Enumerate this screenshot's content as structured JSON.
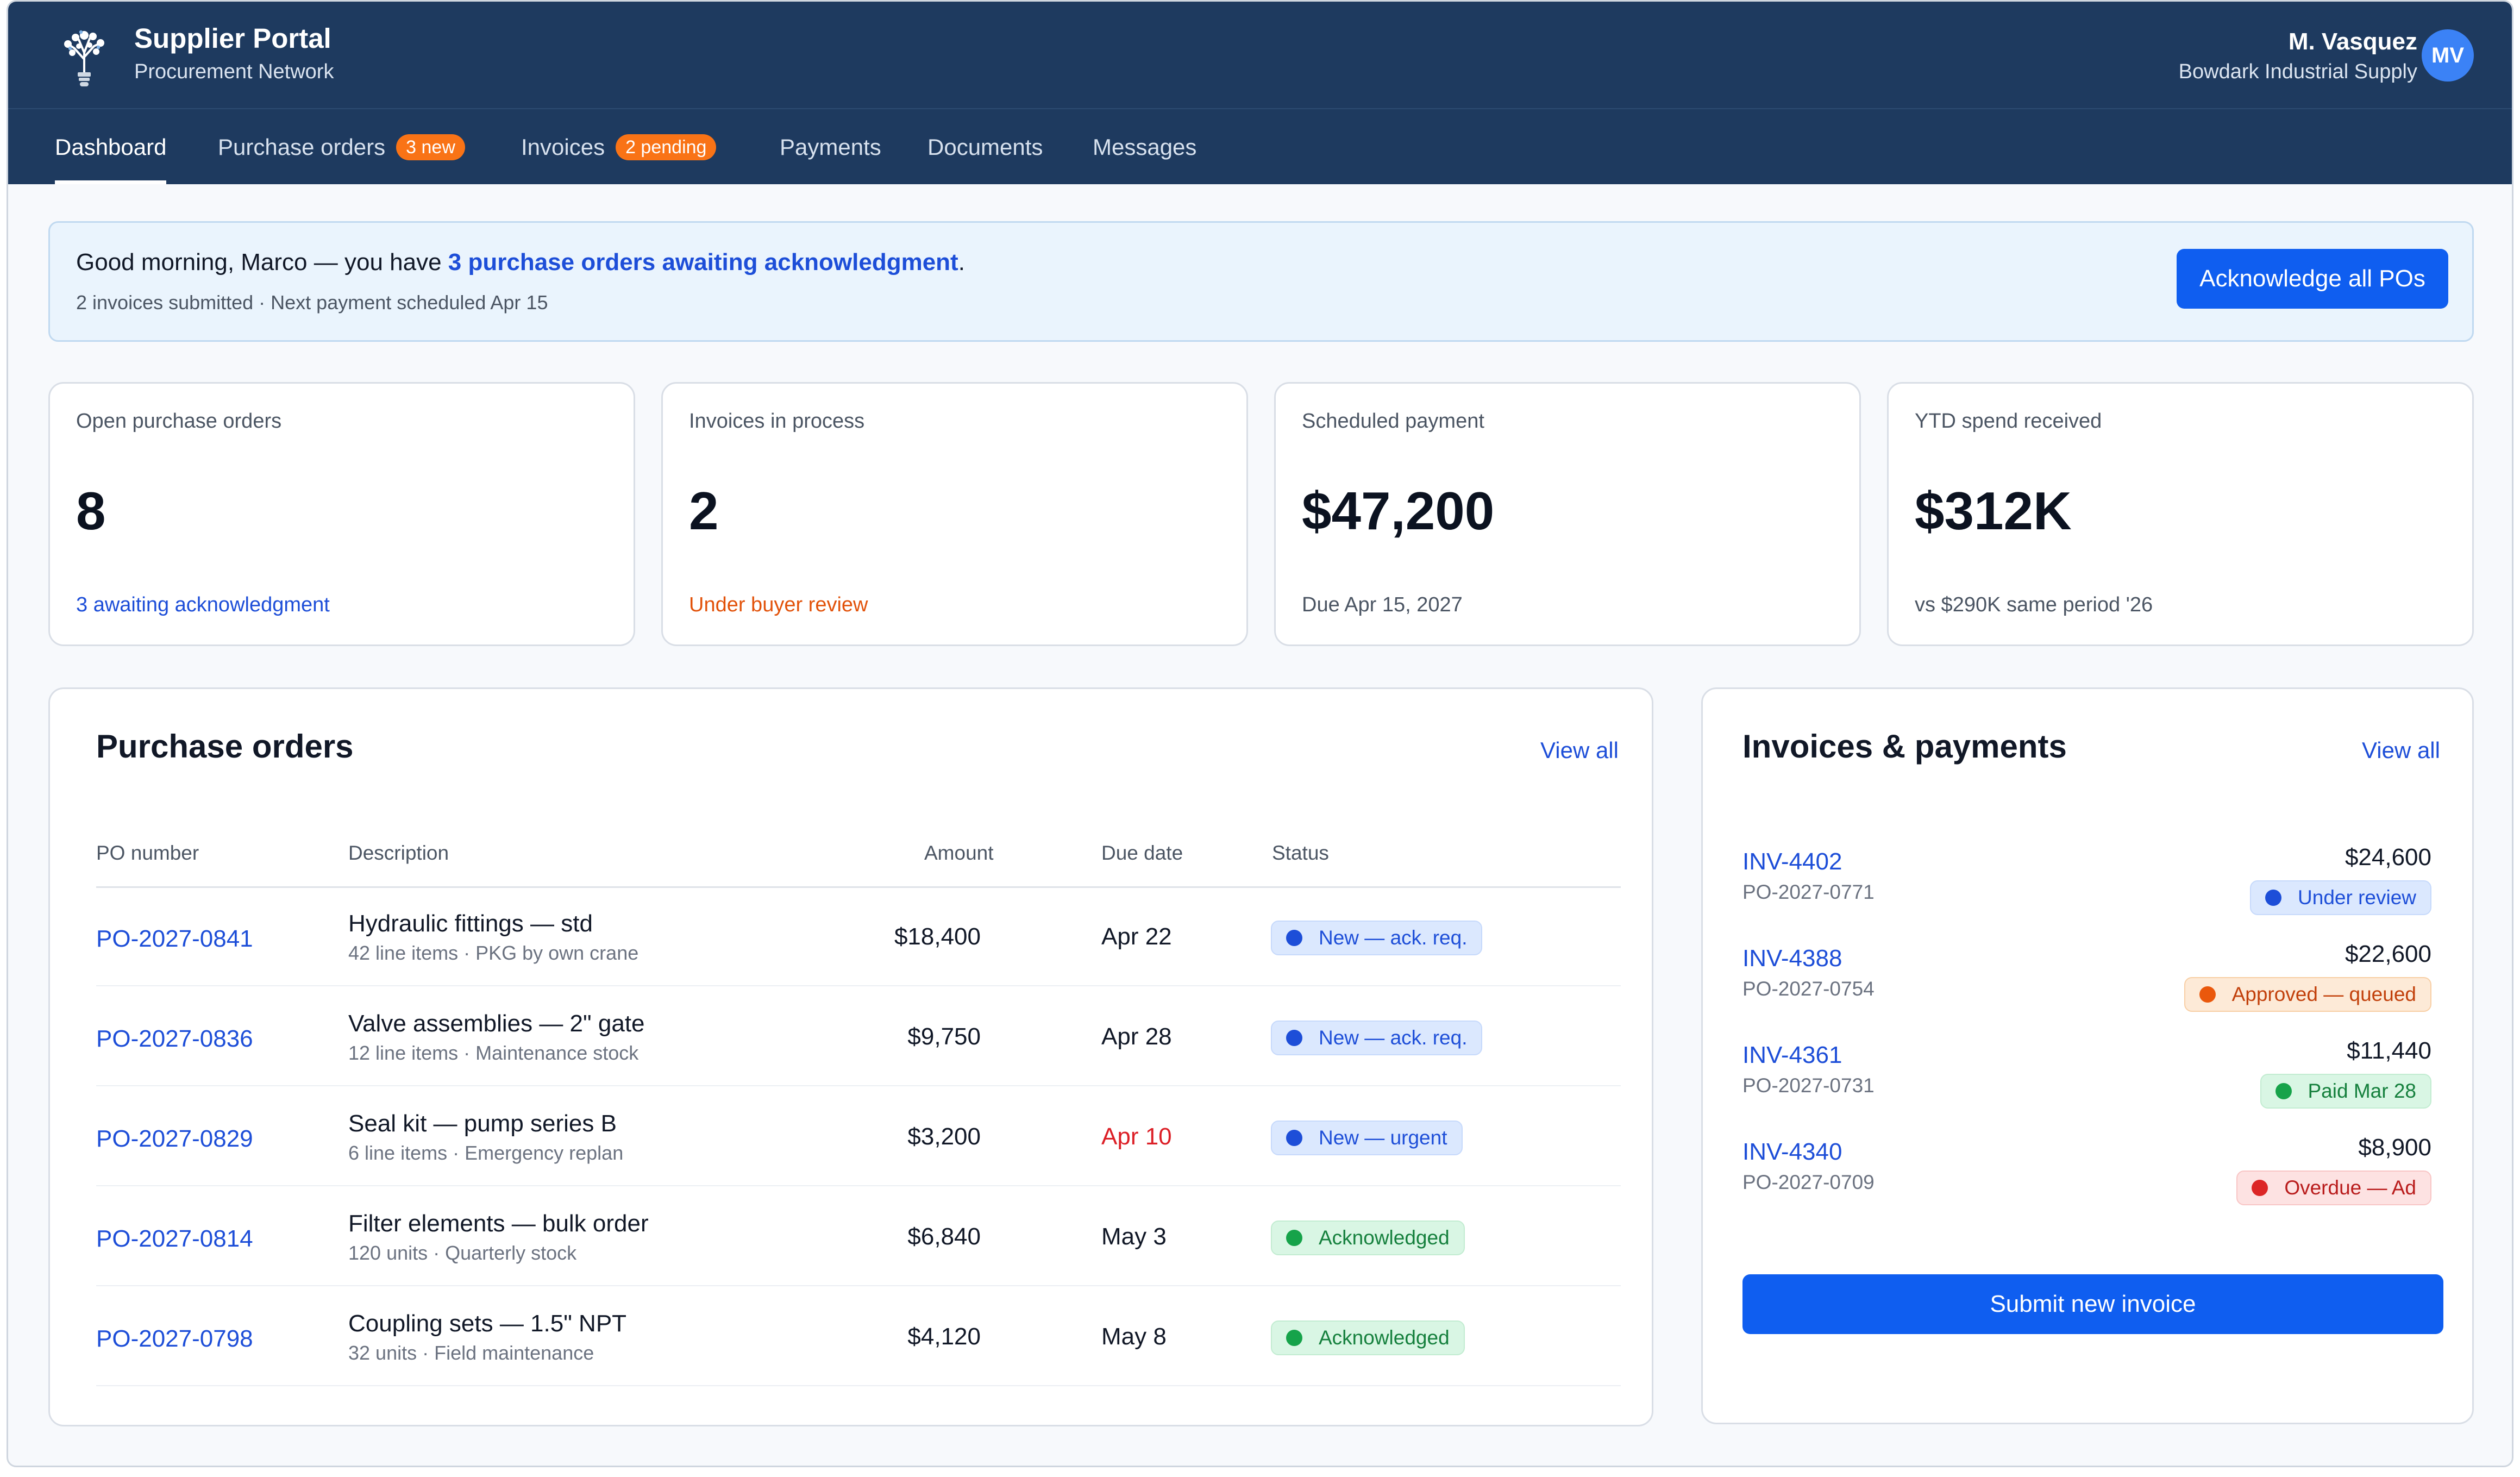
{
  "app": {
    "title": "Supplier Portal",
    "subtitle": "Procurement Network",
    "logo_icon": "lightbulb-tree-icon"
  },
  "user": {
    "name": "M. Vasquez",
    "company": "Bowdark Industrial Supply",
    "initials": "MV"
  },
  "nav": {
    "tabs": [
      {
        "label": "Dashboard",
        "active": true
      },
      {
        "label": "Purchase orders",
        "badge": "3 new"
      },
      {
        "label": "Invoices",
        "badge": "2 pending"
      },
      {
        "label": "Payments"
      },
      {
        "label": "Documents"
      },
      {
        "label": "Messages"
      }
    ]
  },
  "banner": {
    "greeting": "Good morning, Marco — you have ",
    "link": "3 purchase orders awaiting acknowledgment",
    "end": ".",
    "sub": "2 invoices submitted · Next payment scheduled Apr 15",
    "button": "Acknowledge all POs"
  },
  "stats": [
    {
      "label": "Open purchase orders",
      "value": "8",
      "note": "3 awaiting acknowledgment"
    },
    {
      "label": "Invoices in process",
      "value": "2",
      "note": "Under buyer review"
    },
    {
      "label": "Scheduled payment",
      "value": "$47,200",
      "note": "Due Apr 15, 2027"
    },
    {
      "label": "YTD spend received",
      "value": "$312K",
      "note": "vs $290K same period '26"
    }
  ],
  "purchase_orders": {
    "title": "Purchase orders",
    "view_all": "View all",
    "columns": [
      "PO number",
      "Description",
      "Amount",
      "Due date",
      "Status"
    ],
    "rows": [
      {
        "po": "PO-2027-0841",
        "desc": "Hydraulic fittings — std",
        "sub": "42 line items · PKG by own crane",
        "amount": "$18,400",
        "due": "Apr 22",
        "status": "New — ack. req."
      },
      {
        "po": "PO-2027-0836",
        "desc": "Valve assemblies — 2\" gate",
        "sub": "12 line items · Maintenance stock",
        "amount": "$9,750",
        "due": "Apr 28",
        "status": "New — ack. req."
      },
      {
        "po": "PO-2027-0829",
        "desc": "Seal kit — pump series B",
        "sub": "6 line items · Emergency replan",
        "amount": "$3,200",
        "due": "Apr 10",
        "status": "New — urgent"
      },
      {
        "po": "PO-2027-0814",
        "desc": "Filter elements — bulk order",
        "sub": "120 units · Quarterly stock",
        "amount": "$6,840",
        "due": "May 3",
        "status": "Acknowledged"
      },
      {
        "po": "PO-2027-0798",
        "desc": "Coupling sets — 1.5\" NPT",
        "sub": "32 units · Field maintenance",
        "amount": "$4,120",
        "due": "May 8",
        "status": "Acknowledged"
      }
    ]
  },
  "invoices": {
    "title": "Invoices & payments",
    "view_all": "View all",
    "rows": [
      {
        "inv": "INV-4402",
        "po": "PO-2027-0771",
        "amount": "$24,600",
        "status": "Under review"
      },
      {
        "inv": "INV-4388",
        "po": "PO-2027-0754",
        "amount": "$22,600",
        "status": "Approved — queued"
      },
      {
        "inv": "INV-4361",
        "po": "PO-2027-0731",
        "amount": "$11,440",
        "status": "Paid Mar 28"
      },
      {
        "inv": "INV-4340",
        "po": "PO-2027-0709",
        "amount": "$8,900",
        "status": "Overdue — Ad"
      }
    ],
    "submit_button": "Submit new invoice"
  },
  "colors": {
    "header": "#1e3a5f",
    "accent": "#0f5ef0",
    "link": "#1d4ed8",
    "warning": "#e2520a",
    "danger": "#dc1f26"
  }
}
